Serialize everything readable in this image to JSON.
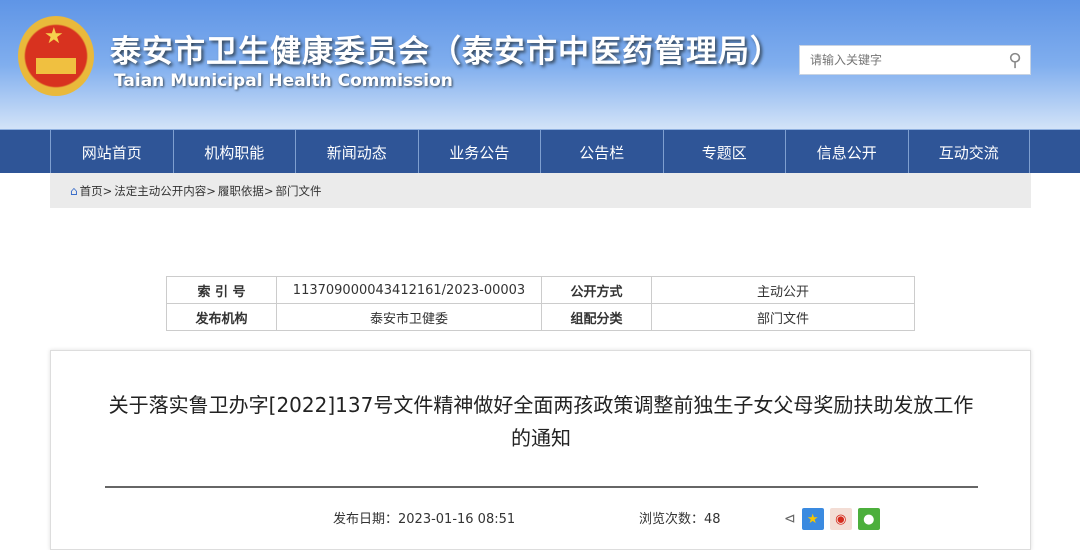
{
  "header": {
    "title": "泰安市卫生健康委员会（泰安市中医药管理局）",
    "subtitle": "Taian Municipal Health Commission",
    "search_placeholder": "请输入关键字"
  },
  "nav": [
    "网站首页",
    "机构职能",
    "新闻动态",
    "业务公告",
    "公告栏",
    "专题区",
    "信息公开",
    "互动交流"
  ],
  "breadcrumb": [
    "首页>",
    "法定主动公开内容>",
    "履职依据>",
    "部门文件"
  ],
  "meta": {
    "index_label": "索 引 号",
    "index_value": "113709000043412161/2023-00003",
    "open_label": "公开方式",
    "open_value": "主动公开",
    "org_label": "发布机构",
    "org_value": "泰安市卫健委",
    "cat_label": "组配分类",
    "cat_value": "部门文件"
  },
  "article": {
    "title": "关于落实鲁卫办字[2022]137号文件精神做好全面两孩政策调整前独生子女父母奖励扶助发放工作的通知",
    "date": "发布日期：2023-01-16 08:51",
    "views": "浏览次数：48"
  }
}
